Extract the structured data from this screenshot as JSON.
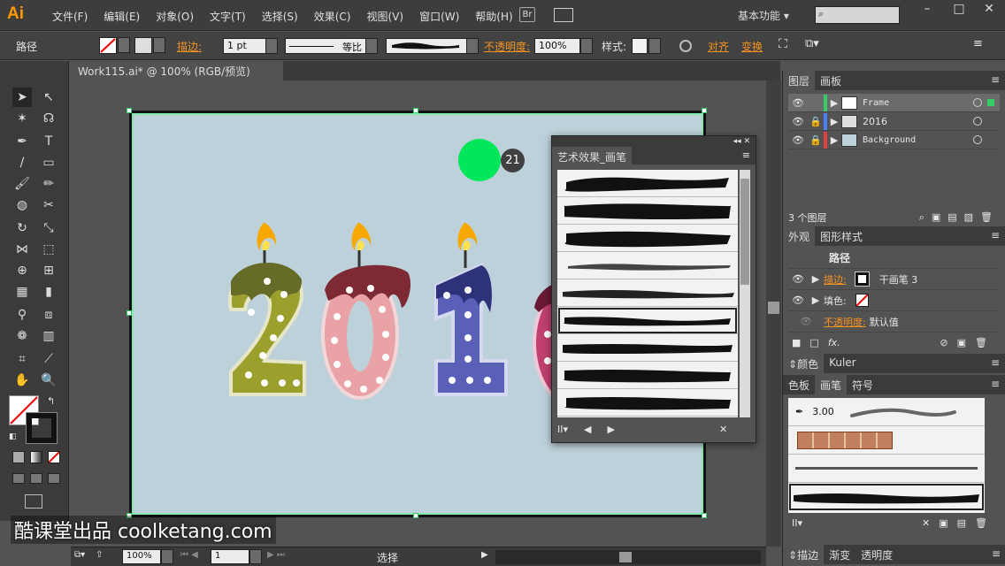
{
  "app": {
    "logo": "Ai",
    "workspace": "基本功能"
  },
  "menu": [
    "文件(F)",
    "编辑(E)",
    "对象(O)",
    "文字(T)",
    "选择(S)",
    "效果(C)",
    "视图(V)",
    "窗口(W)",
    "帮助(H)"
  ],
  "bridge": "Br",
  "window_buttons": [
    "–",
    "□",
    "✕"
  ],
  "control": {
    "object_label": "路径",
    "stroke_label": "描边:",
    "stroke_weight": "1 pt",
    "profile_label": "等比",
    "opacity_label": "不透明度:",
    "opacity_value": "100%",
    "style_label": "样式:",
    "align_label": "对齐",
    "transform_label": "变换"
  },
  "document": {
    "tab_title": "Work115.ai* @ 100% (RGB/预览)"
  },
  "artwork": {
    "digits": [
      "2",
      "0",
      "1",
      "6"
    ],
    "badge": "21"
  },
  "brush_popup": {
    "title": "艺术效果_画笔",
    "brush_count": 9
  },
  "layers": {
    "tabs": [
      "图层",
      "画板"
    ],
    "items": [
      {
        "name": "Frame",
        "color": "#33cc66"
      },
      {
        "name": "2016",
        "color": "#4f7fff"
      },
      {
        "name": "Background",
        "color": "#e04040"
      }
    ],
    "count_label": "3 个图层"
  },
  "appearance": {
    "tabs": [
      "外观",
      "图形样式"
    ],
    "title": "路径",
    "stroke_label": "描边:",
    "stroke_value": "干画笔 3",
    "fill_label": "填色:",
    "opacity_label": "不透明度:",
    "opacity_value": "默认值",
    "fx": "fx."
  },
  "color_tabs": [
    "颜色",
    "Kuler"
  ],
  "brushes": {
    "tabs": [
      "色板",
      "画笔",
      "符号"
    ],
    "calligraphic_size": "3.00"
  },
  "bottom_tabs": [
    "描边",
    "渐变",
    "透明度"
  ],
  "status": {
    "zoom": "100%",
    "page": "1",
    "tool_name": "选择"
  },
  "watermark": "酷课堂出品 coolketang.com"
}
